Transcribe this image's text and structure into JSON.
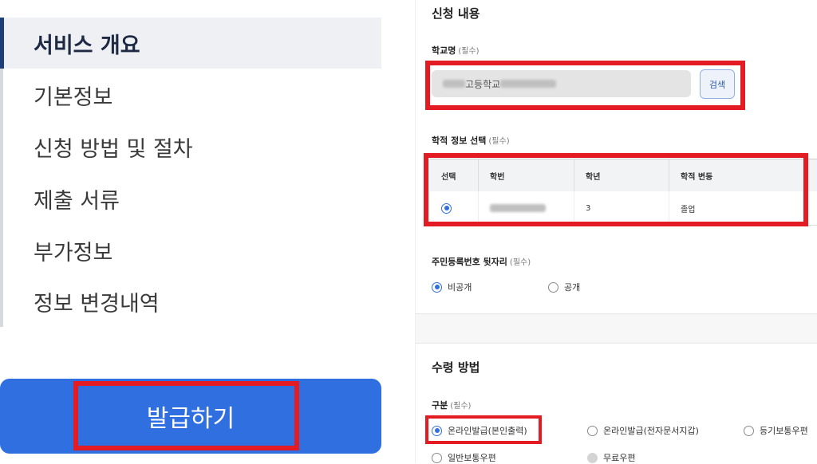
{
  "nav": {
    "items": [
      {
        "label": "서비스 개요",
        "active": true
      },
      {
        "label": "기본정보",
        "active": false
      },
      {
        "label": "신청 방법 및 절차",
        "active": false
      },
      {
        "label": "제출 서류",
        "active": false
      },
      {
        "label": "부가정보",
        "active": false
      },
      {
        "label": "정보 변경내역",
        "active": false
      }
    ]
  },
  "issue_button": {
    "label": "발급하기"
  },
  "application": {
    "title": "신청 내용",
    "school": {
      "label": "학교명",
      "required": "(필수)",
      "value": "고등학교",
      "search_label": "검색"
    },
    "academic": {
      "label": "학적 정보 선택",
      "required": "(필수)",
      "columns": [
        "선택",
        "학번",
        "학년",
        "학적 변동"
      ],
      "rows": [
        {
          "grade": "3",
          "status": "졸업"
        }
      ]
    },
    "resident": {
      "label": "주민등록번호 뒷자리",
      "required": "(필수)",
      "options": [
        {
          "label": "비공개",
          "checked": true
        },
        {
          "label": "공개",
          "checked": false
        }
      ]
    }
  },
  "delivery": {
    "title": "수령 방법",
    "category_label": "구분",
    "required": "(필수)",
    "options": [
      {
        "label": "온라인발급(본인출력)",
        "checked": true
      },
      {
        "label": "온라인발급(전자문서지갑)",
        "checked": false
      },
      {
        "label": "등기보통우편",
        "checked": false
      },
      {
        "label": "일반보통우편",
        "checked": false
      },
      {
        "label": "무료우편",
        "checked": false,
        "disabled": true
      }
    ]
  },
  "colors": {
    "accent": "#2f6fe0",
    "highlight": "#e31b23",
    "nav_active_bar": "#1c3f7a"
  }
}
